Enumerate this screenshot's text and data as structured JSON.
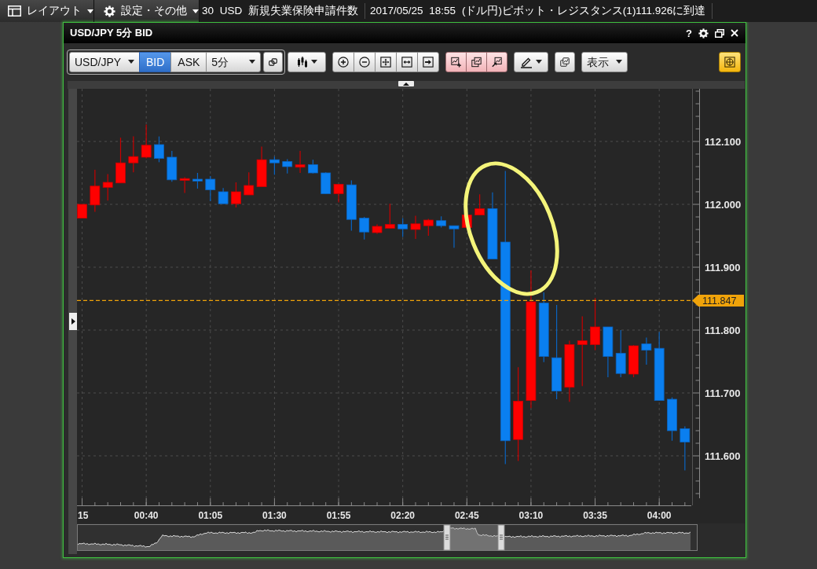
{
  "top_bar": {
    "layout_menu": "レイアウト",
    "settings_menu": "設定・その他",
    "ticker": [
      "30 USD 新規失業保険申請件数",
      "2017/05/25 18:55 (ドル円)ピボット・レジスタンス(1)111.926に到達"
    ]
  },
  "window": {
    "title": "USD/JPY 5分 BID",
    "help": "?"
  },
  "toolbar": {
    "symbol": "USD/JPY",
    "sides": [
      {
        "label": "BID",
        "selected": true
      },
      {
        "label": "ASK",
        "selected": false
      }
    ],
    "interval": "5分",
    "view_menu": "表示",
    "crosshair": {
      "on": true
    }
  },
  "chart": {
    "chart_data": {
      "type": "candlestick",
      "x": [
        15,
        20,
        25,
        30,
        35,
        40,
        45,
        50,
        55,
        60,
        65,
        70,
        75,
        80,
        85,
        90,
        95,
        100,
        105,
        110,
        115,
        120,
        125,
        130,
        135,
        140,
        145,
        150,
        155,
        160,
        165,
        170,
        175,
        180,
        185,
        190,
        195,
        200,
        205,
        210,
        215,
        220,
        225,
        230,
        235,
        240,
        245,
        250
      ],
      "ohlc": [
        [
          111.978,
          112.0,
          111.978,
          112.0
        ],
        [
          111.999,
          112.055,
          111.988,
          112.029
        ],
        [
          112.027,
          112.048,
          112.006,
          112.035
        ],
        [
          112.034,
          112.106,
          112.034,
          112.066
        ],
        [
          112.066,
          112.108,
          112.051,
          112.076
        ],
        [
          112.075,
          112.127,
          112.073,
          112.094
        ],
        [
          112.095,
          112.108,
          112.067,
          112.073
        ],
        [
          112.075,
          112.085,
          112.036,
          112.039
        ],
        [
          112.038,
          112.043,
          112.018,
          112.041
        ],
        [
          112.04,
          112.05,
          112.025,
          112.037
        ],
        [
          112.04,
          112.045,
          112.005,
          112.023
        ],
        [
          112.02,
          112.026,
          112.001,
          112.001
        ],
        [
          112.001,
          112.035,
          111.995,
          112.02
        ],
        [
          112.015,
          112.051,
          112.015,
          112.03
        ],
        [
          112.028,
          112.092,
          112.028,
          112.071
        ],
        [
          112.071,
          112.076,
          112.047,
          112.066
        ],
        [
          112.068,
          112.072,
          112.049,
          112.06
        ],
        [
          112.059,
          112.085,
          112.05,
          112.063
        ],
        [
          112.063,
          112.071,
          112.049,
          112.05
        ],
        [
          112.05,
          112.051,
          112.017,
          112.017
        ],
        [
          112.017,
          112.032,
          112.003,
          112.032
        ],
        [
          112.031,
          112.038,
          111.958,
          111.976
        ],
        [
          111.978,
          111.98,
          111.944,
          111.956
        ],
        [
          111.955,
          111.968,
          111.953,
          111.965
        ],
        [
          111.962,
          112.001,
          111.962,
          111.968
        ],
        [
          111.968,
          111.978,
          111.948,
          111.961
        ],
        [
          111.96,
          111.982,
          111.945,
          111.969
        ],
        [
          111.966,
          111.977,
          111.95,
          111.975
        ],
        [
          111.974,
          111.981,
          111.963,
          111.966
        ],
        [
          111.966,
          111.966,
          111.931,
          111.961
        ],
        [
          111.963,
          111.983,
          111.963,
          111.983
        ],
        [
          111.983,
          112.016,
          111.983,
          111.993
        ],
        [
          111.993,
          112.019,
          111.913,
          111.913
        ],
        [
          111.94,
          112.053,
          111.587,
          111.624
        ],
        [
          111.626,
          111.741,
          111.592,
          111.687
        ],
        [
          111.688,
          111.895,
          111.676,
          111.845
        ],
        [
          111.843,
          111.86,
          111.749,
          111.758
        ],
        [
          111.756,
          111.84,
          111.69,
          111.703
        ],
        [
          111.709,
          111.783,
          111.686,
          111.777
        ],
        [
          111.777,
          111.822,
          111.711,
          111.783
        ],
        [
          111.777,
          111.851,
          111.768,
          111.805
        ],
        [
          111.805,
          111.805,
          111.725,
          111.758
        ],
        [
          111.763,
          111.8,
          111.725,
          111.731
        ],
        [
          111.73,
          111.776,
          111.725,
          111.775
        ],
        [
          111.778,
          111.788,
          111.745,
          111.768
        ],
        [
          111.771,
          111.797,
          111.688,
          111.688
        ],
        [
          111.69,
          111.693,
          111.624,
          111.64
        ],
        [
          111.643,
          111.647,
          111.577,
          111.622
        ]
      ],
      "xlim": [
        13,
        252.5
      ],
      "ylim": [
        111.52,
        112.18
      ],
      "grid": true,
      "yticks": [
        {
          "value": 112.1,
          "label": "112.100"
        },
        {
          "value": 112.0,
          "label": "112.000"
        },
        {
          "value": 111.9,
          "label": "111.900"
        },
        {
          "value": 111.8,
          "label": "111.800"
        },
        {
          "value": 111.7,
          "label": "111.700"
        },
        {
          "value": 111.6,
          "label": "111.600"
        }
      ],
      "xticks": [
        {
          "value": 15,
          "label": "15"
        },
        {
          "value": 40,
          "label": "00:40"
        },
        {
          "value": 65,
          "label": "01:05"
        },
        {
          "value": 90,
          "label": "01:30"
        },
        {
          "value": 115,
          "label": "01:55"
        },
        {
          "value": 140,
          "label": "02:20"
        },
        {
          "value": 165,
          "label": "02:45"
        },
        {
          "value": 190,
          "label": "03:10"
        },
        {
          "value": 215,
          "label": "03:35"
        },
        {
          "value": 240,
          "label": "04:00"
        }
      ],
      "ref_lines": [
        {
          "axis": "y",
          "value": 111.847,
          "label": "111.847",
          "color": "#f0a30a"
        }
      ]
    }
  }
}
